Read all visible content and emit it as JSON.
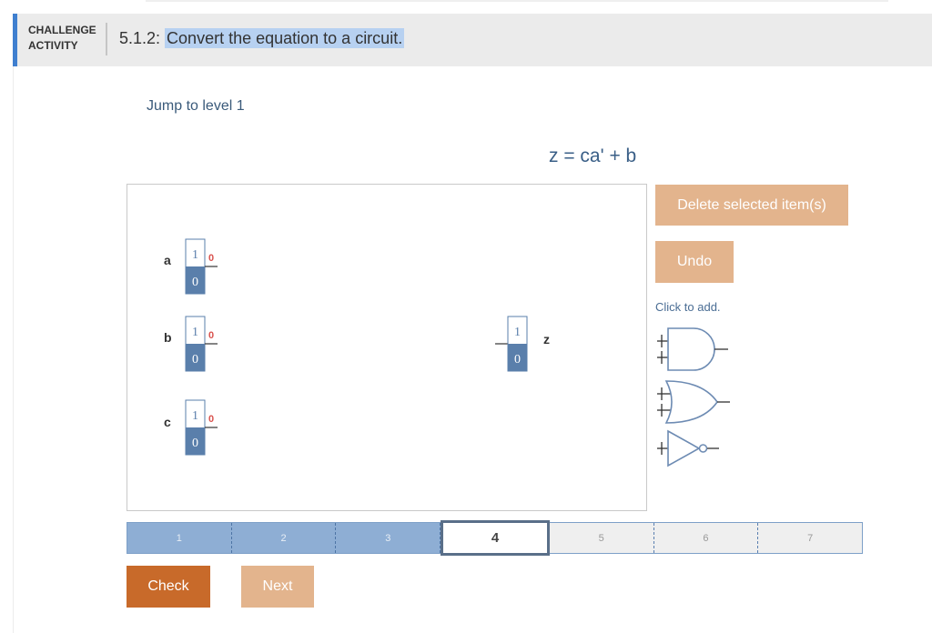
{
  "header": {
    "activity_label": "CHALLENGE ACTIVITY",
    "title_number": "5.1.2: ",
    "title_text": "Convert the equation to a circuit."
  },
  "jump_link": "Jump to level 1",
  "equation": "z = ca' + b",
  "inputs": [
    {
      "name": "a",
      "top_value": "1",
      "bottom_value": "0",
      "output": "0"
    },
    {
      "name": "b",
      "top_value": "1",
      "bottom_value": "0",
      "output": "0"
    },
    {
      "name": "c",
      "top_value": "1",
      "bottom_value": "0",
      "output": "0"
    }
  ],
  "output": {
    "name": "z",
    "top_value": "1",
    "bottom_value": "0"
  },
  "actions": {
    "delete_label": "Delete selected item(s)",
    "undo_label": "Undo",
    "click_to_add": "Click to add."
  },
  "gates": [
    "and-gate-icon",
    "or-gate-icon",
    "not-gate-icon"
  ],
  "levels": [
    {
      "label": "1",
      "state": "done"
    },
    {
      "label": "2",
      "state": "done"
    },
    {
      "label": "3",
      "state": "done"
    },
    {
      "label": "4",
      "state": "current"
    },
    {
      "label": "5",
      "state": "todo"
    },
    {
      "label": "6",
      "state": "todo"
    },
    {
      "label": "7",
      "state": "todo"
    }
  ],
  "footer": {
    "check_label": "Check",
    "next_label": "Next"
  },
  "colors": {
    "accent_blue": "#3f7fcf",
    "button_light": "#e3b48d",
    "button_dark": "#c86a2a",
    "progress_done": "#8eaed4",
    "switch_blue": "#5a7fab",
    "output_red": "#d9534f"
  }
}
